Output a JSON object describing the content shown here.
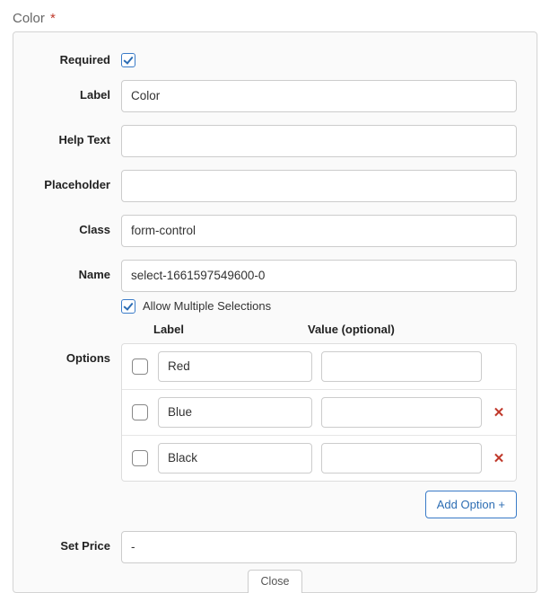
{
  "title": "Color",
  "required_marker": "*",
  "form": {
    "required_label": "Required",
    "required_checked": true,
    "label_label": "Label",
    "label_value": "Color",
    "help_label": "Help Text",
    "help_value": "",
    "placeholder_label": "Placeholder",
    "placeholder_value": "",
    "class_label": "Class",
    "class_value": "form-control",
    "name_label": "Name",
    "name_value": "select-1661597549600-0",
    "allow_multiple_label": "Allow Multiple Selections",
    "allow_multiple_checked": true,
    "options_label": "Options",
    "options_header_label": "Label",
    "options_header_value": "Value (optional)",
    "options": [
      {
        "label": "Red",
        "value": "",
        "checked": false,
        "removable": false
      },
      {
        "label": "Blue",
        "value": "",
        "checked": false,
        "removable": true
      },
      {
        "label": "Black",
        "value": "",
        "checked": false,
        "removable": true
      }
    ],
    "add_option_label": "Add Option +",
    "set_price_label": "Set Price",
    "set_price_value": "-"
  },
  "close_label": "Close"
}
